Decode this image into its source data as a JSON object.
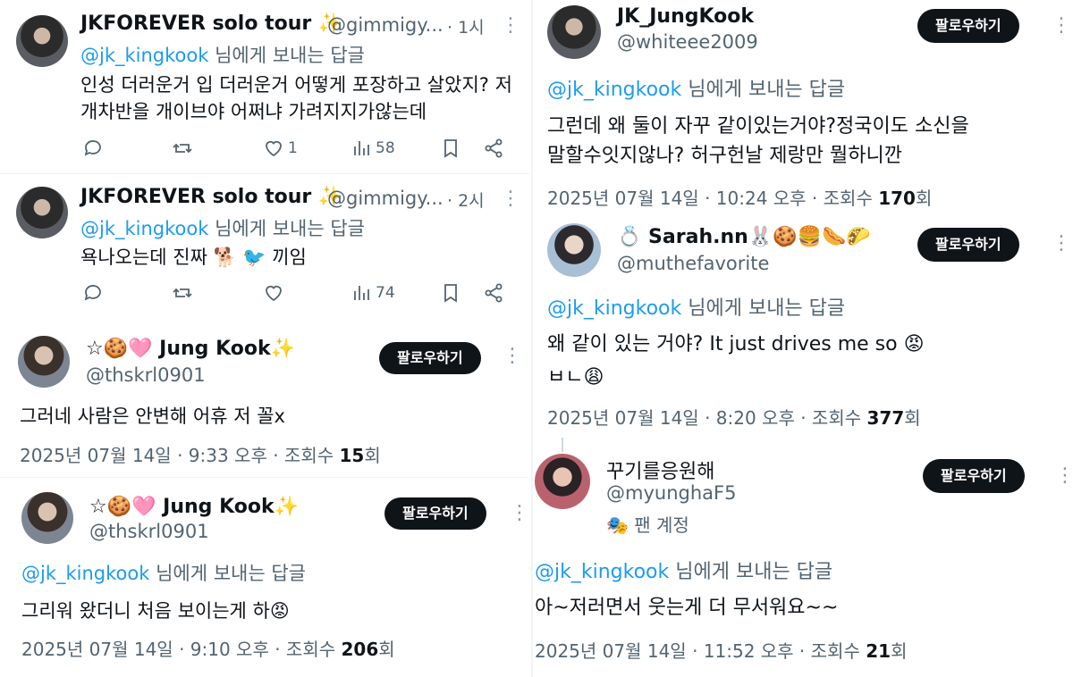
{
  "reply_to_suffix": "님에게 보내는 답글",
  "follow_label": "팔로우하기",
  "left_column": {
    "thread_tweets": [
      {
        "name": "JKFOREVER solo tour ✨",
        "handle": "@gimmigy...",
        "time": "· 1시",
        "mention": "@jk_kingkook",
        "text_lines": [
          "인성 더러운거 입 더러운거 어떻게 포장하고 살았지? 저",
          "개차반을 개이브야 어쩌냐 가려지지가않는데"
        ],
        "like_count": "1",
        "view_count": "58"
      },
      {
        "name": "JKFOREVER solo tour ✨",
        "handle": "@gimmigy...",
        "time": "· 2시",
        "mention": "@jk_kingkook",
        "text_lines": [
          "욕나오는데 진짜 🐕 🐦 끼임"
        ],
        "like_count": "",
        "view_count": "74"
      }
    ],
    "detail_tweets": [
      {
        "name": "☆🍪🩷 Jung Kook✨",
        "handle": "@thskrl0901",
        "mention": "",
        "text": "그러네 사람은 안변해 어휴 저 꼴x",
        "meta": "2025년 07월 14일 · 9:33 오후 · 조회수",
        "views": "15",
        "views_suffix": "회"
      },
      {
        "name": "☆🍪🩷 Jung Kook✨",
        "handle": "@thskrl0901",
        "mention": "@jk_kingkook",
        "text": "그리워 왔더니 처음 보이는게 하😡",
        "meta": "2025년 07월 14일 · 9:10 오후 · 조회수",
        "views": "206",
        "views_suffix": "회"
      }
    ]
  },
  "right_column": [
    {
      "name": "JK_JungKook",
      "handle": "@whiteee2009",
      "badge": "",
      "mention": "@jk_kingkook",
      "text_lines": [
        "그런데 왜 둘이 자꾸 같이있는거야?정국이도 소신을",
        "말할수잇지않나? 허구헌날 제랑만 뭘하니깐"
      ],
      "meta": "2025년 07월 14일 · 10:24 오후 · 조회수",
      "views": "170",
      "views_suffix": "회"
    },
    {
      "name": "💍 Sarah.nn🐰🍪🍔🌭🌮",
      "handle": "@muthefavorite",
      "badge": "",
      "mention": "@jk_kingkook",
      "text_lines": [
        "왜 같이 있는 거야? It just drives me so 😡",
        "ㅂㄴ😩"
      ],
      "meta": "2025년 07월 14일 · 8:20 오후 · 조회수",
      "views": "377",
      "views_suffix": "회"
    },
    {
      "name": "꾸기를응원해",
      "handle": "@myunghaF5",
      "badge": "🎭 팬 계정",
      "mention": "@jk_kingkook",
      "text_lines": [
        "아~저러면서 웃는게 더 무서워요~~"
      ],
      "meta": "2025년 07월 14일 · 11:52 오후 · 조회수",
      "views": "21",
      "views_suffix": "회"
    }
  ],
  "icons": {
    "reply": "reply-icon",
    "retweet": "retweet-icon",
    "like": "heart-icon",
    "views": "views-icon",
    "bookmark": "bookmark-icon",
    "share": "share-icon",
    "more": "more-dots-icon"
  }
}
